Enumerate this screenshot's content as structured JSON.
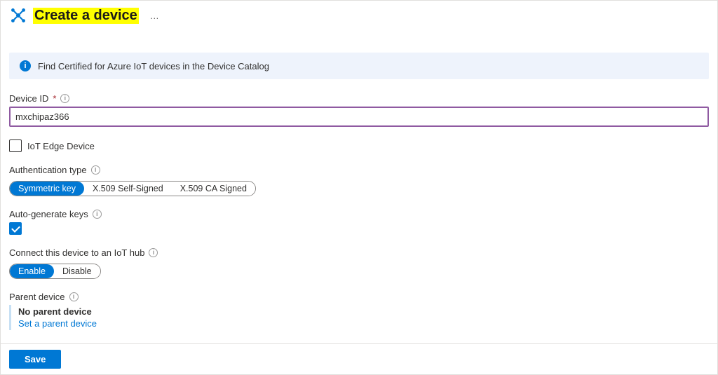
{
  "header": {
    "title": "Create a device",
    "more": "…"
  },
  "banner": {
    "text": "Find Certified for Azure IoT devices in the Device Catalog"
  },
  "device_id": {
    "label": "Device ID",
    "value": "mxchipaz366"
  },
  "iot_edge": {
    "label": "IoT Edge Device",
    "checked": false
  },
  "auth_type": {
    "label": "Authentication type",
    "options": [
      "Symmetric key",
      "X.509 Self-Signed",
      "X.509 CA Signed"
    ],
    "selected_index": 0
  },
  "autogen": {
    "label": "Auto-generate keys",
    "checked": true
  },
  "connect_hub": {
    "label": "Connect this device to an IoT hub",
    "options": [
      "Enable",
      "Disable"
    ],
    "selected_index": 0
  },
  "parent": {
    "label": "Parent device",
    "none_text": "No parent device",
    "set_link": "Set a parent device"
  },
  "footer": {
    "save": "Save"
  }
}
